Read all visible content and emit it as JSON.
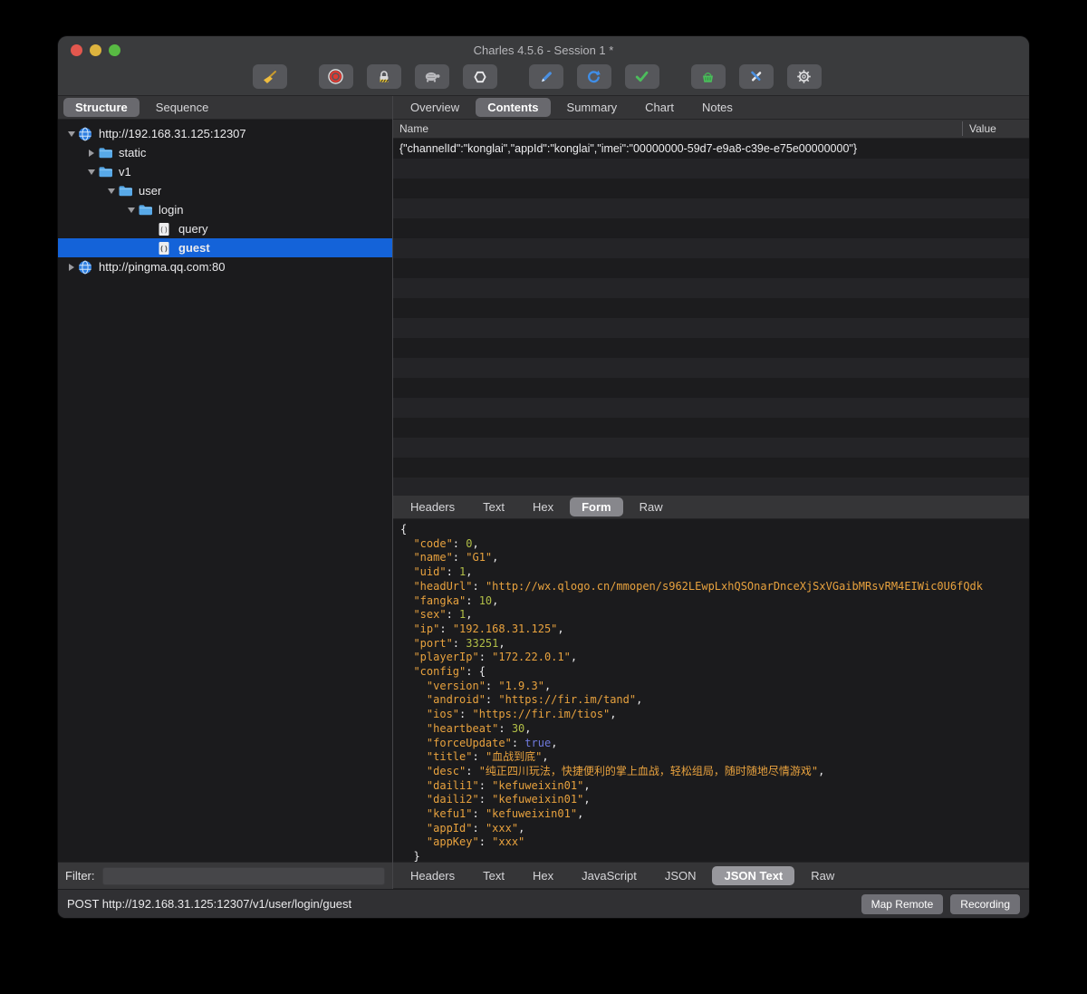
{
  "window": {
    "title": "Charles 4.5.6 - Session 1 *"
  },
  "traffic_lights": [
    "close",
    "minimize",
    "zoom"
  ],
  "toolbar": {
    "buttons": [
      {
        "name": "clear-session",
        "icon": "broom-icon",
        "group_start": false
      },
      {
        "name": "record",
        "icon": "record-icon",
        "group_start": true
      },
      {
        "name": "ssl-proxying",
        "icon": "lock-icon",
        "group_start": false
      },
      {
        "name": "throttling",
        "icon": "turtle-icon",
        "group_start": false
      },
      {
        "name": "breakpoints",
        "icon": "hexagon-icon",
        "group_start": false
      },
      {
        "name": "compose",
        "icon": "pencil-icon",
        "group_start": true
      },
      {
        "name": "repeat",
        "icon": "refresh-icon",
        "group_start": false
      },
      {
        "name": "validate",
        "icon": "check-icon",
        "group_start": false
      },
      {
        "name": "basket",
        "icon": "basket-icon",
        "group_start": true
      },
      {
        "name": "tools",
        "icon": "tools-icon",
        "group_start": false
      },
      {
        "name": "settings",
        "icon": "gear-icon",
        "group_start": false
      }
    ]
  },
  "sidebar": {
    "tabs": [
      {
        "label": "Structure",
        "selected": true
      },
      {
        "label": "Sequence",
        "selected": false
      }
    ],
    "tree": [
      {
        "label": "http://192.168.31.125:12307",
        "icon": "globe",
        "expander": "open",
        "indent": 0,
        "selected": false
      },
      {
        "label": "static",
        "icon": "folder",
        "expander": "closed",
        "indent": 1,
        "selected": false
      },
      {
        "label": "v1",
        "icon": "folder",
        "expander": "open",
        "indent": 1,
        "selected": false
      },
      {
        "label": "user",
        "icon": "folder",
        "expander": "open",
        "indent": 2,
        "selected": false
      },
      {
        "label": "login",
        "icon": "folder",
        "expander": "open",
        "indent": 3,
        "selected": false
      },
      {
        "label": "query",
        "icon": "doc",
        "expander": "none",
        "indent": 4,
        "selected": false
      },
      {
        "label": "guest",
        "icon": "doc",
        "expander": "none",
        "indent": 4,
        "selected": true
      },
      {
        "label": "http://pingma.qq.com:80",
        "icon": "globe",
        "expander": "closed",
        "indent": 0,
        "selected": false
      }
    ],
    "filter_label": "Filter:",
    "filter_value": ""
  },
  "content": {
    "tabs": [
      {
        "label": "Overview",
        "selected": false
      },
      {
        "label": "Contents",
        "selected": true
      },
      {
        "label": "Summary",
        "selected": false
      },
      {
        "label": "Chart",
        "selected": false
      },
      {
        "label": "Notes",
        "selected": false
      }
    ],
    "table": {
      "columns": [
        "Name",
        "Value"
      ],
      "rows": [
        {
          "name": "{\"channelId\":\"konglai\",\"appId\":\"konglai\",\"imei\":\"00000000-59d7-e9a8-c39e-e75e00000000\"}",
          "value": ""
        }
      ]
    },
    "request_tabs": [
      {
        "label": "Headers",
        "selected": false
      },
      {
        "label": "Text",
        "selected": false
      },
      {
        "label": "Hex",
        "selected": false
      },
      {
        "label": "Form",
        "selected": true
      },
      {
        "label": "Raw",
        "selected": false
      }
    ],
    "response_tabs": [
      {
        "label": "Headers",
        "selected": false
      },
      {
        "label": "Text",
        "selected": false
      },
      {
        "label": "Hex",
        "selected": false
      },
      {
        "label": "JavaScript",
        "selected": false
      },
      {
        "label": "JSON",
        "selected": false
      },
      {
        "label": "JSON Text",
        "selected": true
      },
      {
        "label": "Raw",
        "selected": false
      }
    ],
    "json_body": {
      "lines": [
        [
          [
            "p",
            "{"
          ]
        ],
        [
          [
            "k",
            "  \"code\""
          ],
          [
            "p",
            ": "
          ],
          [
            "n",
            "0"
          ],
          [
            "p",
            ","
          ]
        ],
        [
          [
            "k",
            "  \"name\""
          ],
          [
            "p",
            ": "
          ],
          [
            "s",
            "\"G1\""
          ],
          [
            "p",
            ","
          ]
        ],
        [
          [
            "k",
            "  \"uid\""
          ],
          [
            "p",
            ": "
          ],
          [
            "n",
            "1"
          ],
          [
            "p",
            ","
          ]
        ],
        [
          [
            "k",
            "  \"headUrl\""
          ],
          [
            "p",
            ": "
          ],
          [
            "s",
            "\"http://wx.qlogo.cn/mmopen/s962LEwpLxhQSOnarDnceXjSxVGaibMRsvRM4EIWic0U6fQdk"
          ]
        ],
        [
          [
            "k",
            "  \"fangka\""
          ],
          [
            "p",
            ": "
          ],
          [
            "n",
            "10"
          ],
          [
            "p",
            ","
          ]
        ],
        [
          [
            "k",
            "  \"sex\""
          ],
          [
            "p",
            ": "
          ],
          [
            "n",
            "1"
          ],
          [
            "p",
            ","
          ]
        ],
        [
          [
            "k",
            "  \"ip\""
          ],
          [
            "p",
            ": "
          ],
          [
            "s",
            "\"192.168.31.125\""
          ],
          [
            "p",
            ","
          ]
        ],
        [
          [
            "k",
            "  \"port\""
          ],
          [
            "p",
            ": "
          ],
          [
            "n",
            "33251"
          ],
          [
            "p",
            ","
          ]
        ],
        [
          [
            "k",
            "  \"playerIp\""
          ],
          [
            "p",
            ": "
          ],
          [
            "s",
            "\"172.22.0.1\""
          ],
          [
            "p",
            ","
          ]
        ],
        [
          [
            "k",
            "  \"config\""
          ],
          [
            "p",
            ": {"
          ]
        ],
        [
          [
            "k",
            "    \"version\""
          ],
          [
            "p",
            ": "
          ],
          [
            "s",
            "\"1.9.3\""
          ],
          [
            "p",
            ","
          ]
        ],
        [
          [
            "k",
            "    \"android\""
          ],
          [
            "p",
            ": "
          ],
          [
            "s",
            "\"https://fir.im/tand\""
          ],
          [
            "p",
            ","
          ]
        ],
        [
          [
            "k",
            "    \"ios\""
          ],
          [
            "p",
            ": "
          ],
          [
            "s",
            "\"https://fir.im/tios\""
          ],
          [
            "p",
            ","
          ]
        ],
        [
          [
            "k",
            "    \"heartbeat\""
          ],
          [
            "p",
            ": "
          ],
          [
            "n",
            "30"
          ],
          [
            "p",
            ","
          ]
        ],
        [
          [
            "k",
            "    \"forceUpdate\""
          ],
          [
            "p",
            ": "
          ],
          [
            "b",
            "true"
          ],
          [
            "p",
            ","
          ]
        ],
        [
          [
            "k",
            "    \"title\""
          ],
          [
            "p",
            ": "
          ],
          [
            "s",
            "\"血战到底\""
          ],
          [
            "p",
            ","
          ]
        ],
        [
          [
            "k",
            "    \"desc\""
          ],
          [
            "p",
            ": "
          ],
          [
            "s",
            "\"纯正四川玩法，快捷便利的掌上血战，轻松组局，随时随地尽情游戏\""
          ],
          [
            "p",
            ","
          ]
        ],
        [
          [
            "k",
            "    \"daili1\""
          ],
          [
            "p",
            ": "
          ],
          [
            "s",
            "\"kefuweixin01\""
          ],
          [
            "p",
            ","
          ]
        ],
        [
          [
            "k",
            "    \"daili2\""
          ],
          [
            "p",
            ": "
          ],
          [
            "s",
            "\"kefuweixin01\""
          ],
          [
            "p",
            ","
          ]
        ],
        [
          [
            "k",
            "    \"kefu1\""
          ],
          [
            "p",
            ": "
          ],
          [
            "s",
            "\"kefuweixin01\""
          ],
          [
            "p",
            ","
          ]
        ],
        [
          [
            "k",
            "    \"appId\""
          ],
          [
            "p",
            ": "
          ],
          [
            "s",
            "\"xxx\""
          ],
          [
            "p",
            ","
          ]
        ],
        [
          [
            "k",
            "    \"appKey\""
          ],
          [
            "p",
            ": "
          ],
          [
            "s",
            "\"xxx\""
          ]
        ],
        [
          [
            "p",
            "  }"
          ]
        ]
      ]
    }
  },
  "statusbar": {
    "text": "POST http://192.168.31.125:12307/v1/user/login/guest",
    "buttons": [
      "Map Remote",
      "Recording"
    ]
  },
  "colors": {
    "selection_blue": "#1463d9",
    "syntax_key": "#e8a23e",
    "syntax_string": "#e8a23e",
    "syntax_number": "#b2bf47",
    "syntax_boolean": "#6f79dd",
    "chrome_gray": "#3a3b3d"
  }
}
